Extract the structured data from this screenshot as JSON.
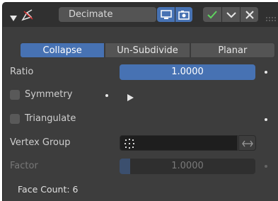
{
  "header": {
    "collapse_icon": "triangle-down-icon",
    "modifier_icon": "decimate-modifier-icon",
    "modifier_name": "Decimate",
    "buttons": [
      "display-in-viewport-icon",
      "display-in-render-icon",
      "check-icon",
      "chevron-down-icon",
      "close-icon"
    ]
  },
  "modes": [
    "Collapse",
    "Un-Subdivide",
    "Planar"
  ],
  "ratio": {
    "label": "Ratio",
    "value": "1.0000",
    "fill_fraction": 1.0
  },
  "symmetry": {
    "label": "Symmetry",
    "checked": false
  },
  "triangulate": {
    "label": "Triangulate",
    "checked": false
  },
  "vertex_group": {
    "label": "Vertex Group",
    "value": ""
  },
  "factor": {
    "label": "Factor",
    "value": "1.0000",
    "fill_fraction": 0.0
  },
  "face_count": "Face Count: 6",
  "colors": {
    "accent": "#4772b3",
    "panel": "#3d3d3d",
    "header": "#303030",
    "field": "#545454"
  }
}
